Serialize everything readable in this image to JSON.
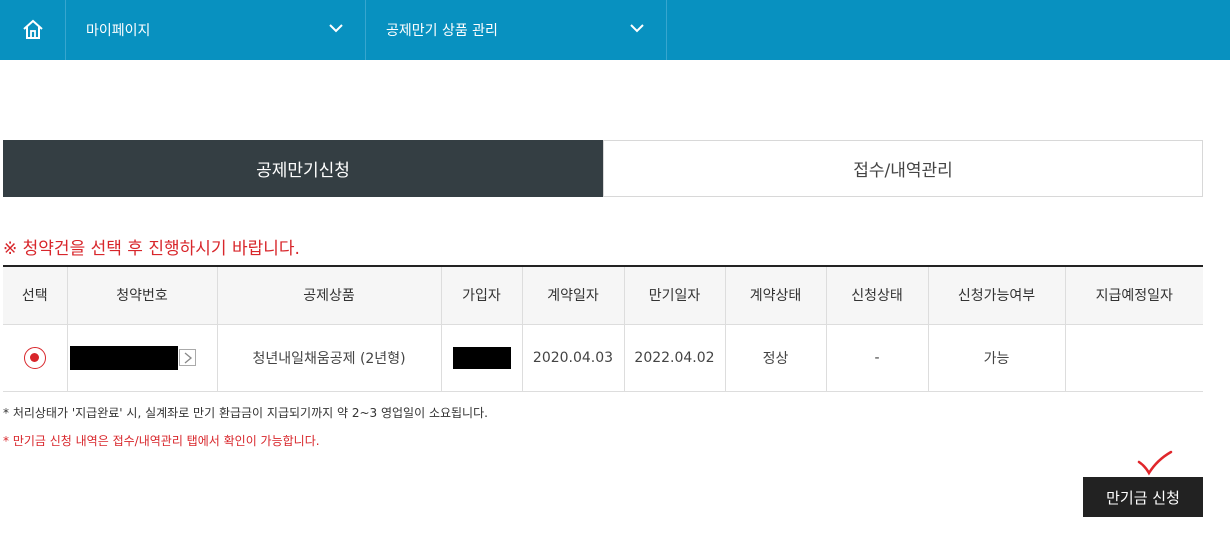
{
  "nav": {
    "home_icon": "home-icon",
    "menu1": {
      "label": "마이페이지",
      "icon": "chevron-down-icon"
    },
    "menu2": {
      "label": "공제만기 상품 관리",
      "icon": "chevron-down-icon"
    },
    "bg_color": "#0891c0"
  },
  "tabs": [
    {
      "label": "공제만기신청",
      "active": true
    },
    {
      "label": "접수/내역관리",
      "active": false
    }
  ],
  "warning": "※ 청약건을 선택 후 진행하시기 바랍니다.",
  "table": {
    "headers": [
      "선택",
      "청약번호",
      "공제상품",
      "가입자",
      "계약일자",
      "만기일자",
      "계약상태",
      "신청상태",
      "신청가능여부",
      "지급예정일자"
    ],
    "rows": [
      {
        "selected": true,
        "contract_no": "",
        "product": "청년내일채움공제 (2년형)",
        "subscriber": "",
        "contract_date": "2020.04.03",
        "maturity_date": "2022.04.02",
        "contract_status": "정상",
        "apply_status": "-",
        "availability": "가능",
        "payment_date": ""
      }
    ]
  },
  "notes": [
    "* 처리상태가 '지급완료' 시, 실계좌로 만기 환급금이 지급되기까지 약 2~3 영업일이 소요됩니다.",
    "* 만기금 신청 내역은 접수/내역관리 탭에서 확인이 가능합니다."
  ],
  "apply_button": "만기금 신청",
  "colors": {
    "accent_red": "#d8262b",
    "dark": "#343e43",
    "button": "#222222"
  }
}
